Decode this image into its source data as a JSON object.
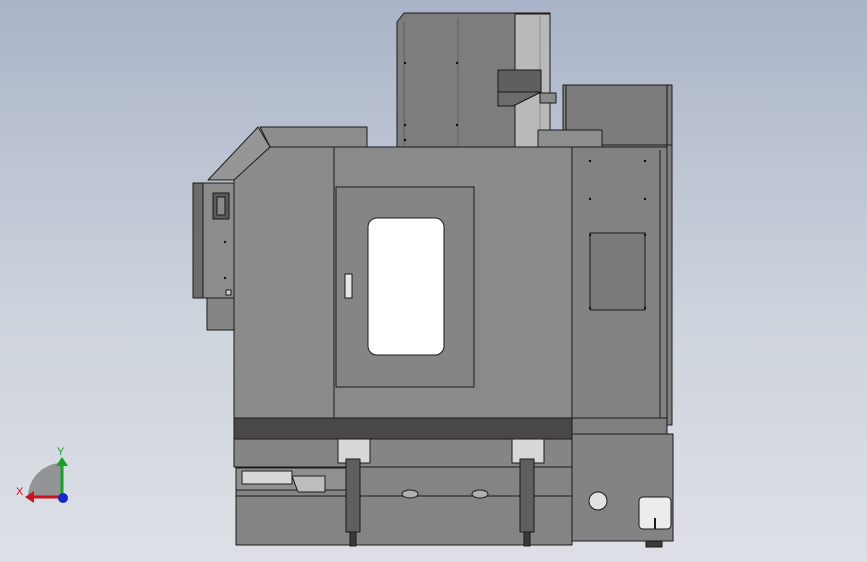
{
  "viewport": {
    "background_top": "#aab4c8",
    "background_bottom": "#dde0e6"
  },
  "model": {
    "body_color": "#8a8a8a",
    "panel_color": "#7f7f7f",
    "dark_band_color": "#4a4748",
    "edge_color": "#1a1a1a",
    "window_color": "#ffffff"
  },
  "triad": {
    "x_label": "X",
    "y_label": "Y",
    "x_color": "#c8141e",
    "y_color": "#14a02a",
    "z_color": "#1428c8"
  }
}
